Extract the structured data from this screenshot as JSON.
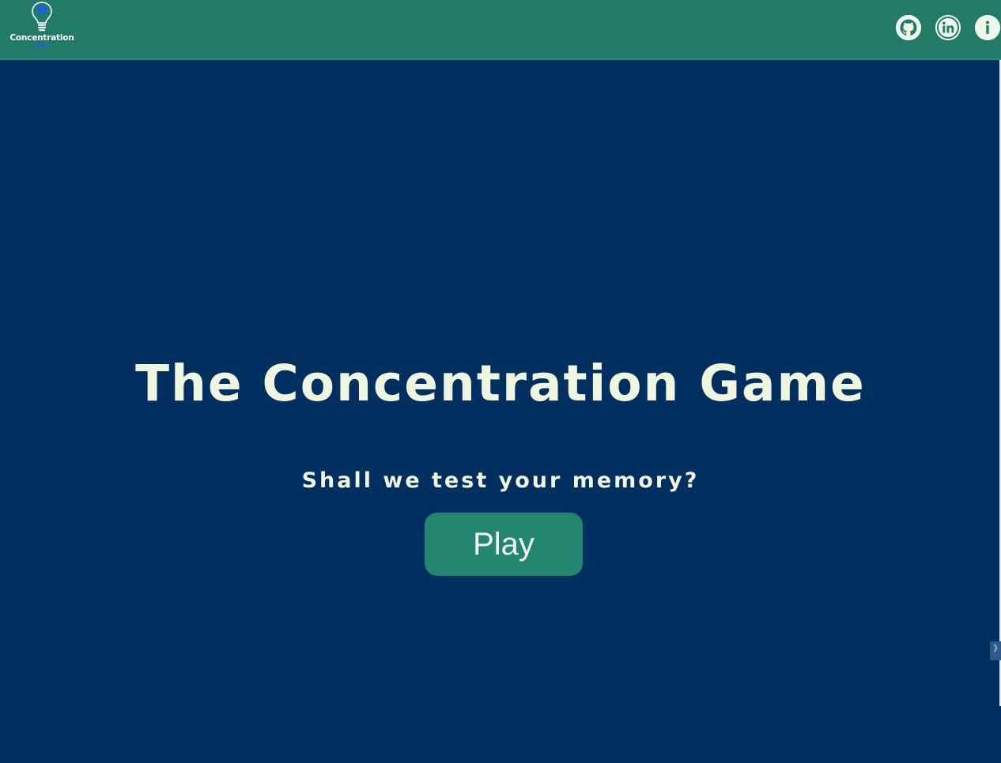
{
  "header": {
    "logo": {
      "title": "Concentration",
      "subtitle": "Game",
      "icon": "lightbulb-brain-icon"
    },
    "links": [
      {
        "name": "github",
        "icon": "github-icon"
      },
      {
        "name": "linkedin",
        "icon": "linkedin-icon",
        "glyph": "in"
      },
      {
        "name": "info",
        "icon": "info-icon",
        "glyph": "i"
      }
    ]
  },
  "main": {
    "title": "The Concentration Game",
    "subtitle": "Shall we test your memory?",
    "play_label": "Play"
  },
  "side_tab": {
    "glyph": "❯"
  },
  "colors": {
    "header_bg": "#227b68",
    "page_bg": "#012f5f",
    "text": "#eef6df",
    "button_bg": "#238671",
    "icon_bg": "#eef7e8",
    "logo_sub": "#1d5fe0"
  }
}
